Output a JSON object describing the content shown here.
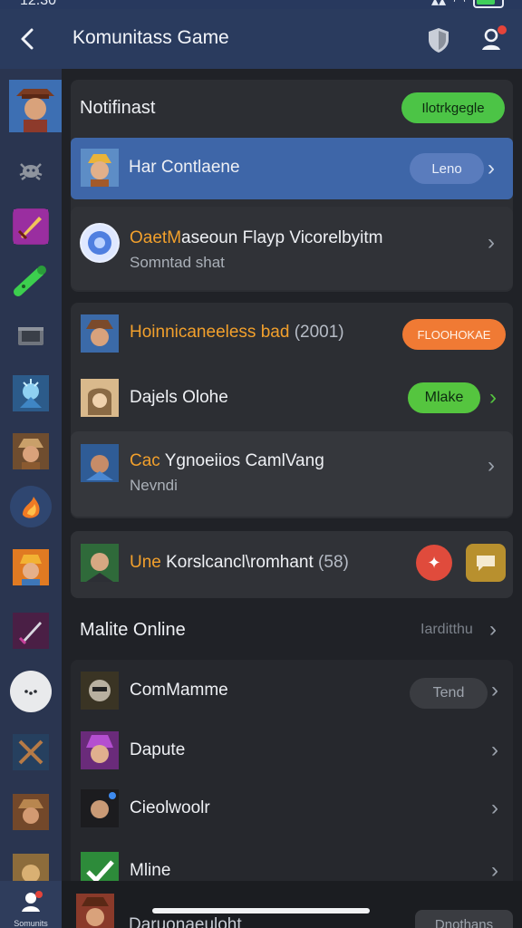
{
  "status": {
    "time": "12:30"
  },
  "header": {
    "title": "Komunitass Game"
  },
  "colors": {
    "header_bg": "#2a3b5e",
    "sidebar_bg": "#2a3550",
    "accent_blue": "#3e66a8",
    "green": "#55c53f",
    "orange": "#f07a34",
    "red": "#e04b3c"
  },
  "sidebar": {
    "items": [
      {
        "icon": "character-avatar"
      },
      {
        "icon": "crab-icon"
      },
      {
        "icon": "sword-icon"
      },
      {
        "icon": "green-wand-icon"
      },
      {
        "icon": "chest-icon"
      },
      {
        "icon": "ice-character-icon"
      },
      {
        "icon": "warrior-avatar"
      },
      {
        "icon": "flame-icon"
      },
      {
        "icon": "hero-avatar"
      },
      {
        "icon": "dagger-icon"
      },
      {
        "icon": "ghost-icon"
      },
      {
        "icon": "crossed-swords-icon"
      },
      {
        "icon": "bandit-avatar"
      },
      {
        "icon": "knight-avatar"
      }
    ],
    "bottom_label": "Somunits"
  },
  "main": {
    "section1": {
      "title": "Notifinast",
      "button": "Ilotrkgegle"
    },
    "selected_row": {
      "title": "Har Contlaene",
      "button": "Leno"
    },
    "notif_row": {
      "title_highlight": "OaetM",
      "title_rest": "aseoun Flayp Vicorelbyitm",
      "subtitle": "Somntad shat"
    },
    "friend_row1": {
      "title": "Hoinnicaneeless bad",
      "count": "(2001)",
      "button": "FLOOHOKAE"
    },
    "friend_row2": {
      "title": "Dajels Olohe",
      "button": "Mlake"
    },
    "friend_row3": {
      "title_highlight": "Cac",
      "title_rest": " Ygnoeiios CamlVang",
      "subtitle": "Nevndi"
    },
    "friend_row4": {
      "title_highlight": "Une",
      "title_rest": " Korslcancl\\romhant",
      "count": "(58)"
    },
    "online_section": {
      "title": "Malite Online",
      "right_text": "Iarditthu"
    },
    "online_rows": [
      {
        "name": "ComMamme",
        "button": "Tend"
      },
      {
        "name": "Dapute"
      },
      {
        "name": "Cieolwoolr"
      },
      {
        "name": "Mline"
      }
    ],
    "bottom_row": {
      "name": "Daruonaeuloht",
      "button": "Dnothans"
    }
  }
}
